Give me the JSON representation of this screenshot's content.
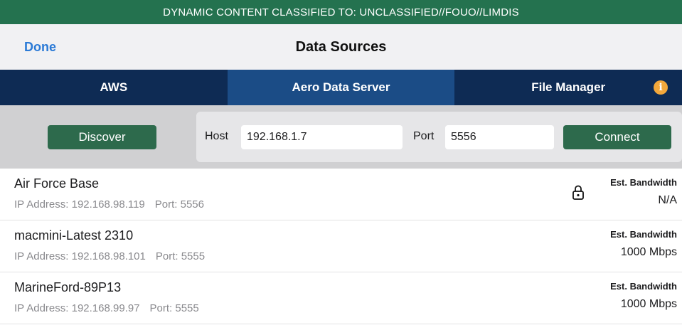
{
  "banner": {
    "text": "DYNAMIC CONTENT CLASSIFIED TO: UNCLASSIFIED//FOUO//LIMDIS"
  },
  "navbar": {
    "done_label": "Done",
    "title": "Data Sources"
  },
  "tabs": [
    {
      "label": "AWS",
      "active": false
    },
    {
      "label": "Aero Data Server",
      "active": true
    },
    {
      "label": "File Manager",
      "active": false
    }
  ],
  "info_icon": {
    "glyph": "i",
    "icon": "info-icon"
  },
  "controls": {
    "discover_label": "Discover",
    "host_label": "Host",
    "host_value": "192.168.1.7",
    "port_label": "Port",
    "port_value": "5556",
    "connect_label": "Connect"
  },
  "servers": [
    {
      "name": "Air Force Base",
      "ip": "IP Address: 192.168.98.119",
      "port": "Port: 5556",
      "bw_label": "Est. Bandwidth",
      "bw_value": "N/A",
      "locked": true
    },
    {
      "name": "macmini-Latest 2310",
      "ip": "IP Address: 192.168.98.101",
      "port": "Port: 5555",
      "bw_label": "Est. Bandwidth",
      "bw_value": "1000 Mbps",
      "locked": false
    },
    {
      "name": "MarineFord-89P13",
      "ip": "IP Address: 192.168.99.97",
      "port": "Port: 5555",
      "bw_label": "Est. Bandwidth",
      "bw_value": "1000 Mbps",
      "locked": false
    }
  ],
  "colors": {
    "banner": "#24724f",
    "tabbar": "#0e2b54",
    "tab_active": "#1b4c86",
    "button": "#2d6a4c",
    "link": "#2b7ad6",
    "info": "#f3a83b"
  }
}
